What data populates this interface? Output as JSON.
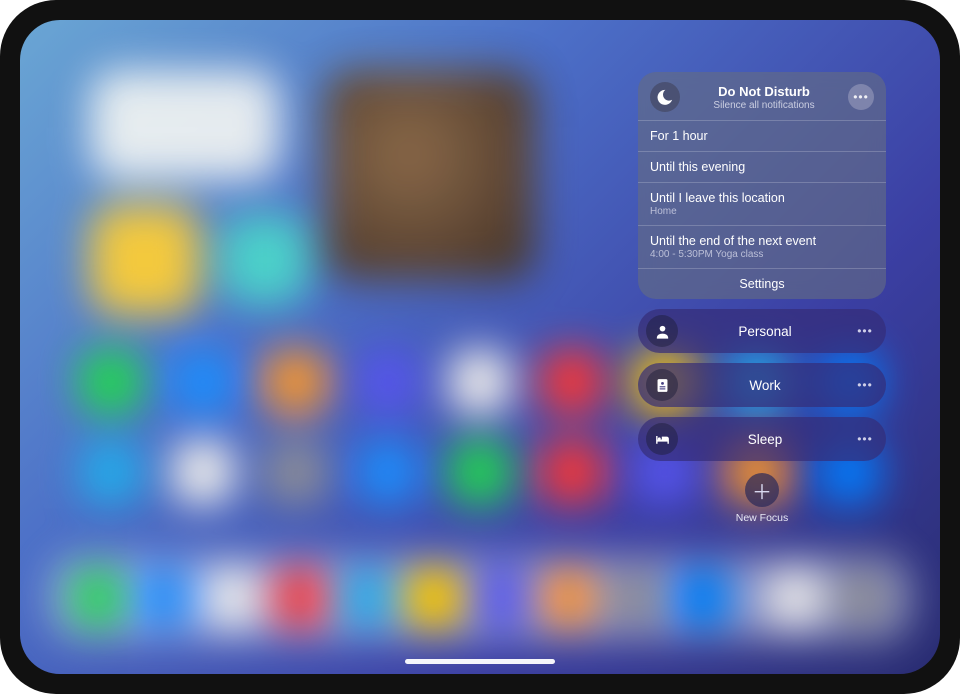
{
  "dnd": {
    "title": "Do Not Disturb",
    "subtitle": "Silence all notifications",
    "options": [
      {
        "label": "For 1 hour",
        "sub": ""
      },
      {
        "label": "Until this evening",
        "sub": ""
      },
      {
        "label": "Until I leave this location",
        "sub": "Home"
      },
      {
        "label": "Until the end of the next event",
        "sub": "4:00 - 5:30PM Yoga class"
      }
    ],
    "settings_label": "Settings"
  },
  "focus_modes": [
    {
      "key": "personal",
      "label": "Personal"
    },
    {
      "key": "work",
      "label": "Work"
    },
    {
      "key": "sleep",
      "label": "Sleep"
    }
  ],
  "new_focus_label": "New Focus"
}
